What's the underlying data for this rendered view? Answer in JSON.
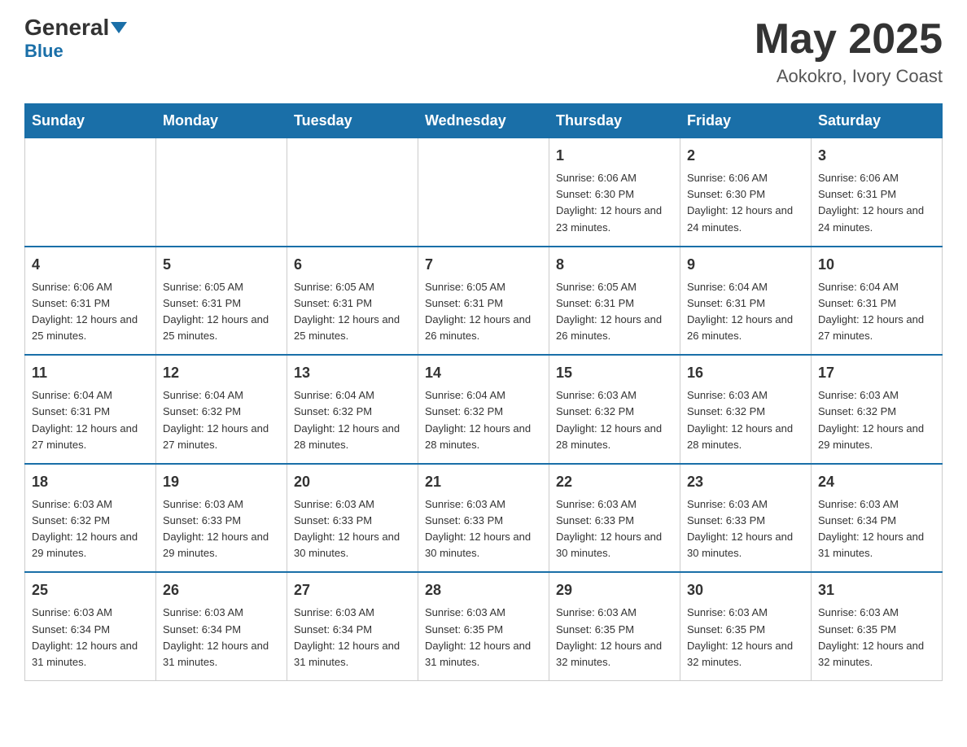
{
  "header": {
    "logo_general": "General",
    "logo_blue": "Blue",
    "month_year": "May 2025",
    "location": "Aokokro, Ivory Coast"
  },
  "calendar": {
    "days_of_week": [
      "Sunday",
      "Monday",
      "Tuesday",
      "Wednesday",
      "Thursday",
      "Friday",
      "Saturday"
    ],
    "weeks": [
      [
        {
          "day": "",
          "info": ""
        },
        {
          "day": "",
          "info": ""
        },
        {
          "day": "",
          "info": ""
        },
        {
          "day": "",
          "info": ""
        },
        {
          "day": "1",
          "info": "Sunrise: 6:06 AM\nSunset: 6:30 PM\nDaylight: 12 hours and 23 minutes."
        },
        {
          "day": "2",
          "info": "Sunrise: 6:06 AM\nSunset: 6:30 PM\nDaylight: 12 hours and 24 minutes."
        },
        {
          "day": "3",
          "info": "Sunrise: 6:06 AM\nSunset: 6:31 PM\nDaylight: 12 hours and 24 minutes."
        }
      ],
      [
        {
          "day": "4",
          "info": "Sunrise: 6:06 AM\nSunset: 6:31 PM\nDaylight: 12 hours and 25 minutes."
        },
        {
          "day": "5",
          "info": "Sunrise: 6:05 AM\nSunset: 6:31 PM\nDaylight: 12 hours and 25 minutes."
        },
        {
          "day": "6",
          "info": "Sunrise: 6:05 AM\nSunset: 6:31 PM\nDaylight: 12 hours and 25 minutes."
        },
        {
          "day": "7",
          "info": "Sunrise: 6:05 AM\nSunset: 6:31 PM\nDaylight: 12 hours and 26 minutes."
        },
        {
          "day": "8",
          "info": "Sunrise: 6:05 AM\nSunset: 6:31 PM\nDaylight: 12 hours and 26 minutes."
        },
        {
          "day": "9",
          "info": "Sunrise: 6:04 AM\nSunset: 6:31 PM\nDaylight: 12 hours and 26 minutes."
        },
        {
          "day": "10",
          "info": "Sunrise: 6:04 AM\nSunset: 6:31 PM\nDaylight: 12 hours and 27 minutes."
        }
      ],
      [
        {
          "day": "11",
          "info": "Sunrise: 6:04 AM\nSunset: 6:31 PM\nDaylight: 12 hours and 27 minutes."
        },
        {
          "day": "12",
          "info": "Sunrise: 6:04 AM\nSunset: 6:32 PM\nDaylight: 12 hours and 27 minutes."
        },
        {
          "day": "13",
          "info": "Sunrise: 6:04 AM\nSunset: 6:32 PM\nDaylight: 12 hours and 28 minutes."
        },
        {
          "day": "14",
          "info": "Sunrise: 6:04 AM\nSunset: 6:32 PM\nDaylight: 12 hours and 28 minutes."
        },
        {
          "day": "15",
          "info": "Sunrise: 6:03 AM\nSunset: 6:32 PM\nDaylight: 12 hours and 28 minutes."
        },
        {
          "day": "16",
          "info": "Sunrise: 6:03 AM\nSunset: 6:32 PM\nDaylight: 12 hours and 28 minutes."
        },
        {
          "day": "17",
          "info": "Sunrise: 6:03 AM\nSunset: 6:32 PM\nDaylight: 12 hours and 29 minutes."
        }
      ],
      [
        {
          "day": "18",
          "info": "Sunrise: 6:03 AM\nSunset: 6:32 PM\nDaylight: 12 hours and 29 minutes."
        },
        {
          "day": "19",
          "info": "Sunrise: 6:03 AM\nSunset: 6:33 PM\nDaylight: 12 hours and 29 minutes."
        },
        {
          "day": "20",
          "info": "Sunrise: 6:03 AM\nSunset: 6:33 PM\nDaylight: 12 hours and 30 minutes."
        },
        {
          "day": "21",
          "info": "Sunrise: 6:03 AM\nSunset: 6:33 PM\nDaylight: 12 hours and 30 minutes."
        },
        {
          "day": "22",
          "info": "Sunrise: 6:03 AM\nSunset: 6:33 PM\nDaylight: 12 hours and 30 minutes."
        },
        {
          "day": "23",
          "info": "Sunrise: 6:03 AM\nSunset: 6:33 PM\nDaylight: 12 hours and 30 minutes."
        },
        {
          "day": "24",
          "info": "Sunrise: 6:03 AM\nSunset: 6:34 PM\nDaylight: 12 hours and 31 minutes."
        }
      ],
      [
        {
          "day": "25",
          "info": "Sunrise: 6:03 AM\nSunset: 6:34 PM\nDaylight: 12 hours and 31 minutes."
        },
        {
          "day": "26",
          "info": "Sunrise: 6:03 AM\nSunset: 6:34 PM\nDaylight: 12 hours and 31 minutes."
        },
        {
          "day": "27",
          "info": "Sunrise: 6:03 AM\nSunset: 6:34 PM\nDaylight: 12 hours and 31 minutes."
        },
        {
          "day": "28",
          "info": "Sunrise: 6:03 AM\nSunset: 6:35 PM\nDaylight: 12 hours and 31 minutes."
        },
        {
          "day": "29",
          "info": "Sunrise: 6:03 AM\nSunset: 6:35 PM\nDaylight: 12 hours and 32 minutes."
        },
        {
          "day": "30",
          "info": "Sunrise: 6:03 AM\nSunset: 6:35 PM\nDaylight: 12 hours and 32 minutes."
        },
        {
          "day": "31",
          "info": "Sunrise: 6:03 AM\nSunset: 6:35 PM\nDaylight: 12 hours and 32 minutes."
        }
      ]
    ]
  }
}
